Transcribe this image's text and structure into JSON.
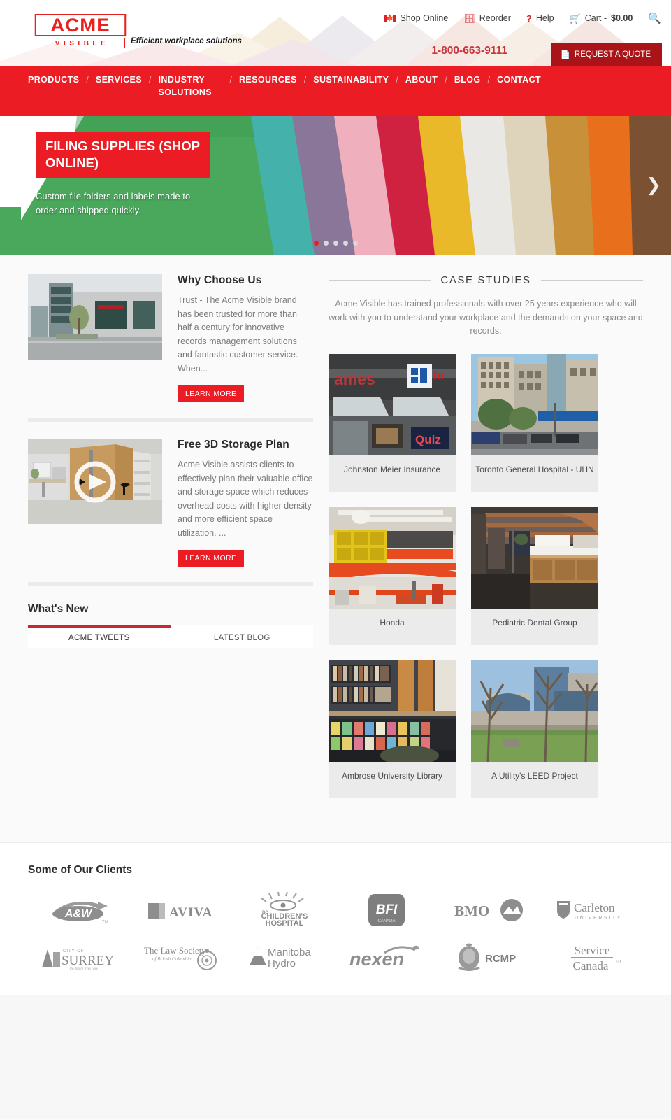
{
  "brand": {
    "logo_primary": "ACME",
    "logo_secondary": "VISIBLE",
    "tagline": "Efficient workplace solutions",
    "accent_red": "#ec1c24",
    "dark_red": "#a91419"
  },
  "utility": {
    "shop_online": "Shop Online",
    "reorder": "Reorder",
    "help": "Help",
    "cart_label": "Cart - ",
    "cart_amount": "$0.00",
    "search_icon": "search-icon",
    "flag_icon": "canada-flag-icon"
  },
  "contact": {
    "phone": "1-800-663-9111",
    "quote_button": "REQUEST A QUOTE"
  },
  "nav": {
    "items": [
      "PRODUCTS",
      "SERVICES",
      "INDUSTRY SOLUTIONS",
      "RESOURCES",
      "SUSTAINABILITY",
      "ABOUT",
      "BLOG",
      "CONTACT"
    ],
    "separator": "/"
  },
  "hero": {
    "title": "FILING SUPPLIES (SHOP ONLINE)",
    "subtitle": "Custom file folders and labels made to order and shipped quickly.",
    "prev_icon": "chevron-left-icon",
    "next_icon": "chevron-right-icon",
    "slide_count": 5,
    "active_slide": 1
  },
  "features": [
    {
      "title": "Why Choose Us",
      "text": "Trust - The Acme Visible brand has been trusted for more than half a century for innovative records management solutions and fantastic customer service. When...",
      "button": "LEARN MORE",
      "thumb": "office-building-photo",
      "has_video": false
    },
    {
      "title": "Free 3D Storage Plan",
      "text": "Acme Visible assists clients to effectively plan their valuable office and storage space which reduces overhead costs with higher density and more efficient space utilization. ...",
      "button": "LEARN MORE",
      "thumb": "3d-storage-render",
      "has_video": true
    }
  ],
  "whats_new": {
    "title": "What's New",
    "tabs": [
      {
        "label": "ACME TWEETS",
        "active": true
      },
      {
        "label": "LATEST BLOG",
        "active": false
      }
    ]
  },
  "case_studies": {
    "heading": "CASE STUDIES",
    "intro": "Acme Visible has trained professionals with over 25 years experience who will work with you to understand your workplace and the demands on your space and records.",
    "items": [
      {
        "label": "Johnston Meier Insurance",
        "image": "storefront-photo"
      },
      {
        "label": "Toronto General Hospital - UHN",
        "image": "hospital-building-photo"
      },
      {
        "label": "Honda",
        "image": "warehouse-interior-photo"
      },
      {
        "label": "Pediatric Dental Group",
        "image": "dental-office-photo"
      },
      {
        "label": "Ambrose University Library",
        "image": "library-shelves-photo"
      },
      {
        "label": "A Utility's LEED Project",
        "image": "leed-building-photo"
      }
    ]
  },
  "clients": {
    "title": "Some of Our Clients",
    "logos": [
      {
        "name": "A&W",
        "sub": "TM"
      },
      {
        "name": "AVIVA",
        "sub": ""
      },
      {
        "name": "BC CHILDREN'S HOSPITAL",
        "sub": ""
      },
      {
        "name": "BFI",
        "sub": "CANADA"
      },
      {
        "name": "BMO",
        "sub": ""
      },
      {
        "name": "Carleton",
        "sub": "UNIVERSITY"
      },
      {
        "name": "SURREY",
        "sub": "CITY OF"
      },
      {
        "name": "The Law Society",
        "sub": "of British Columbia"
      },
      {
        "name": "Manitoba",
        "sub": "Hydro"
      },
      {
        "name": "nexen",
        "sub": ""
      },
      {
        "name": "RCMP",
        "sub": ""
      },
      {
        "name": "Service",
        "sub": "Canada"
      }
    ]
  }
}
